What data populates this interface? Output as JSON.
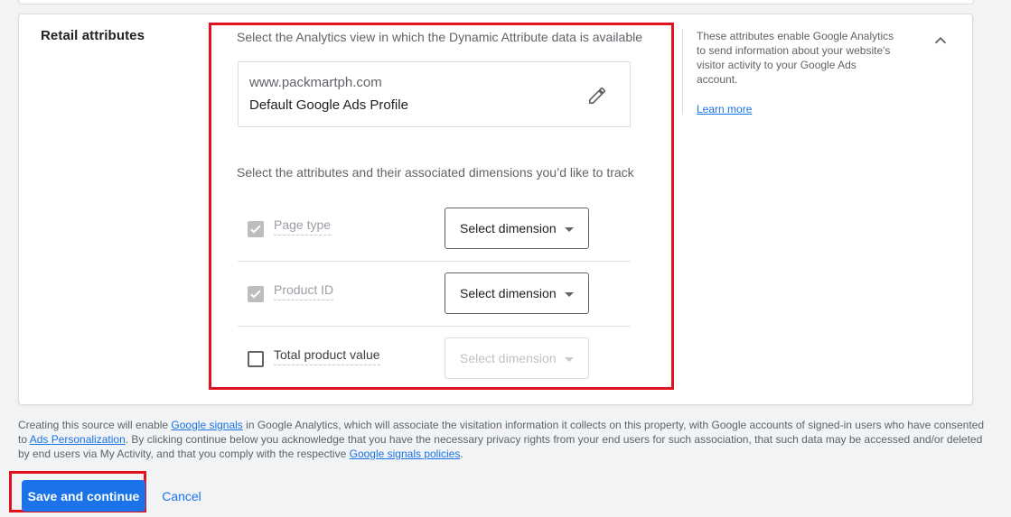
{
  "section": {
    "title": "Retail attributes",
    "view_prompt": "Select the Analytics view in which the Dynamic Attribute data is available",
    "view": {
      "url": "www.packmartph.com",
      "profile": "Default Google Ads Profile",
      "edit_icon": "pencil-icon"
    },
    "attributes_prompt": "Select the attributes and their associated dimensions you’d like to track",
    "attributes": [
      {
        "name": "Page type",
        "checked": true,
        "enabled": false,
        "dimension": "Select dimension",
        "dimension_enabled": true
      },
      {
        "name": "Product ID",
        "checked": true,
        "enabled": false,
        "dimension": "Select dimension",
        "dimension_enabled": true
      },
      {
        "name": "Total product value",
        "checked": false,
        "enabled": true,
        "dimension": "Select dimension",
        "dimension_enabled": false
      }
    ],
    "help_text": "These attributes enable Google Analytics to send information about your website's visitor activity to your Google Ads account.",
    "learn_more": "Learn more",
    "collapse_icon": "chevron-up-icon"
  },
  "disclaimer": {
    "p1": "Creating this source will enable ",
    "link1": "Google signals",
    "p2": " in Google Analytics, which will associate the visitation information it collects on this property, with Google accounts of signed-in users who have consented to ",
    "link2": "Ads Personalization",
    "p3": ". By clicking continue below you acknowledge that you have the necessary privacy rights from your end users for such association, that such data may be accessed and/or deleted by end users via My Activity, and that you comply with the respective ",
    "link3": "Google signals policies",
    "p4": "."
  },
  "actions": {
    "save_label": "Save and continue",
    "cancel_label": "Cancel"
  },
  "colors": {
    "accent": "#1a73e8",
    "highlight": "#e0121e"
  }
}
